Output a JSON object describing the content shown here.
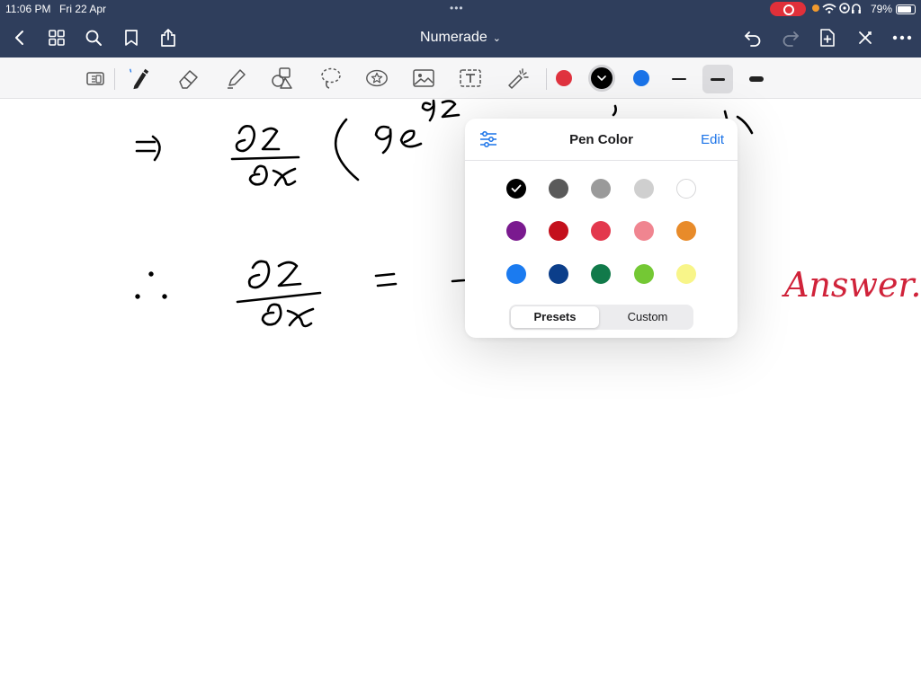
{
  "status": {
    "time": "11:06 PM",
    "date": "Fri 22 Apr",
    "battery": "79%"
  },
  "titlebar": {
    "title": "Numerade"
  },
  "toolbar": {
    "colors": [
      "#e0333f",
      "#000000",
      "#1a73e8"
    ],
    "active_color_index": 1
  },
  "popover": {
    "title": "Pen Color",
    "edit_label": "Edit",
    "selected": "#000000",
    "colors": [
      [
        "#000000",
        "#5a5a5a",
        "#9a9a9a",
        "#cfcfcf",
        "#ffffff"
      ],
      [
        "#7a1a8f",
        "#c4101c",
        "#e3384d",
        "#f08590",
        "#e88b2a"
      ],
      [
        "#1b7bf0",
        "#0b3e8a",
        "#117a4a",
        "#74c834",
        "#f8f589"
      ]
    ],
    "tabs": [
      "Presets",
      "Custom"
    ],
    "active_tab": 0
  },
  "handwriting": {
    "answer": "Answer.",
    "answer_color": "#d0233a",
    "ink_color": "#000000"
  }
}
